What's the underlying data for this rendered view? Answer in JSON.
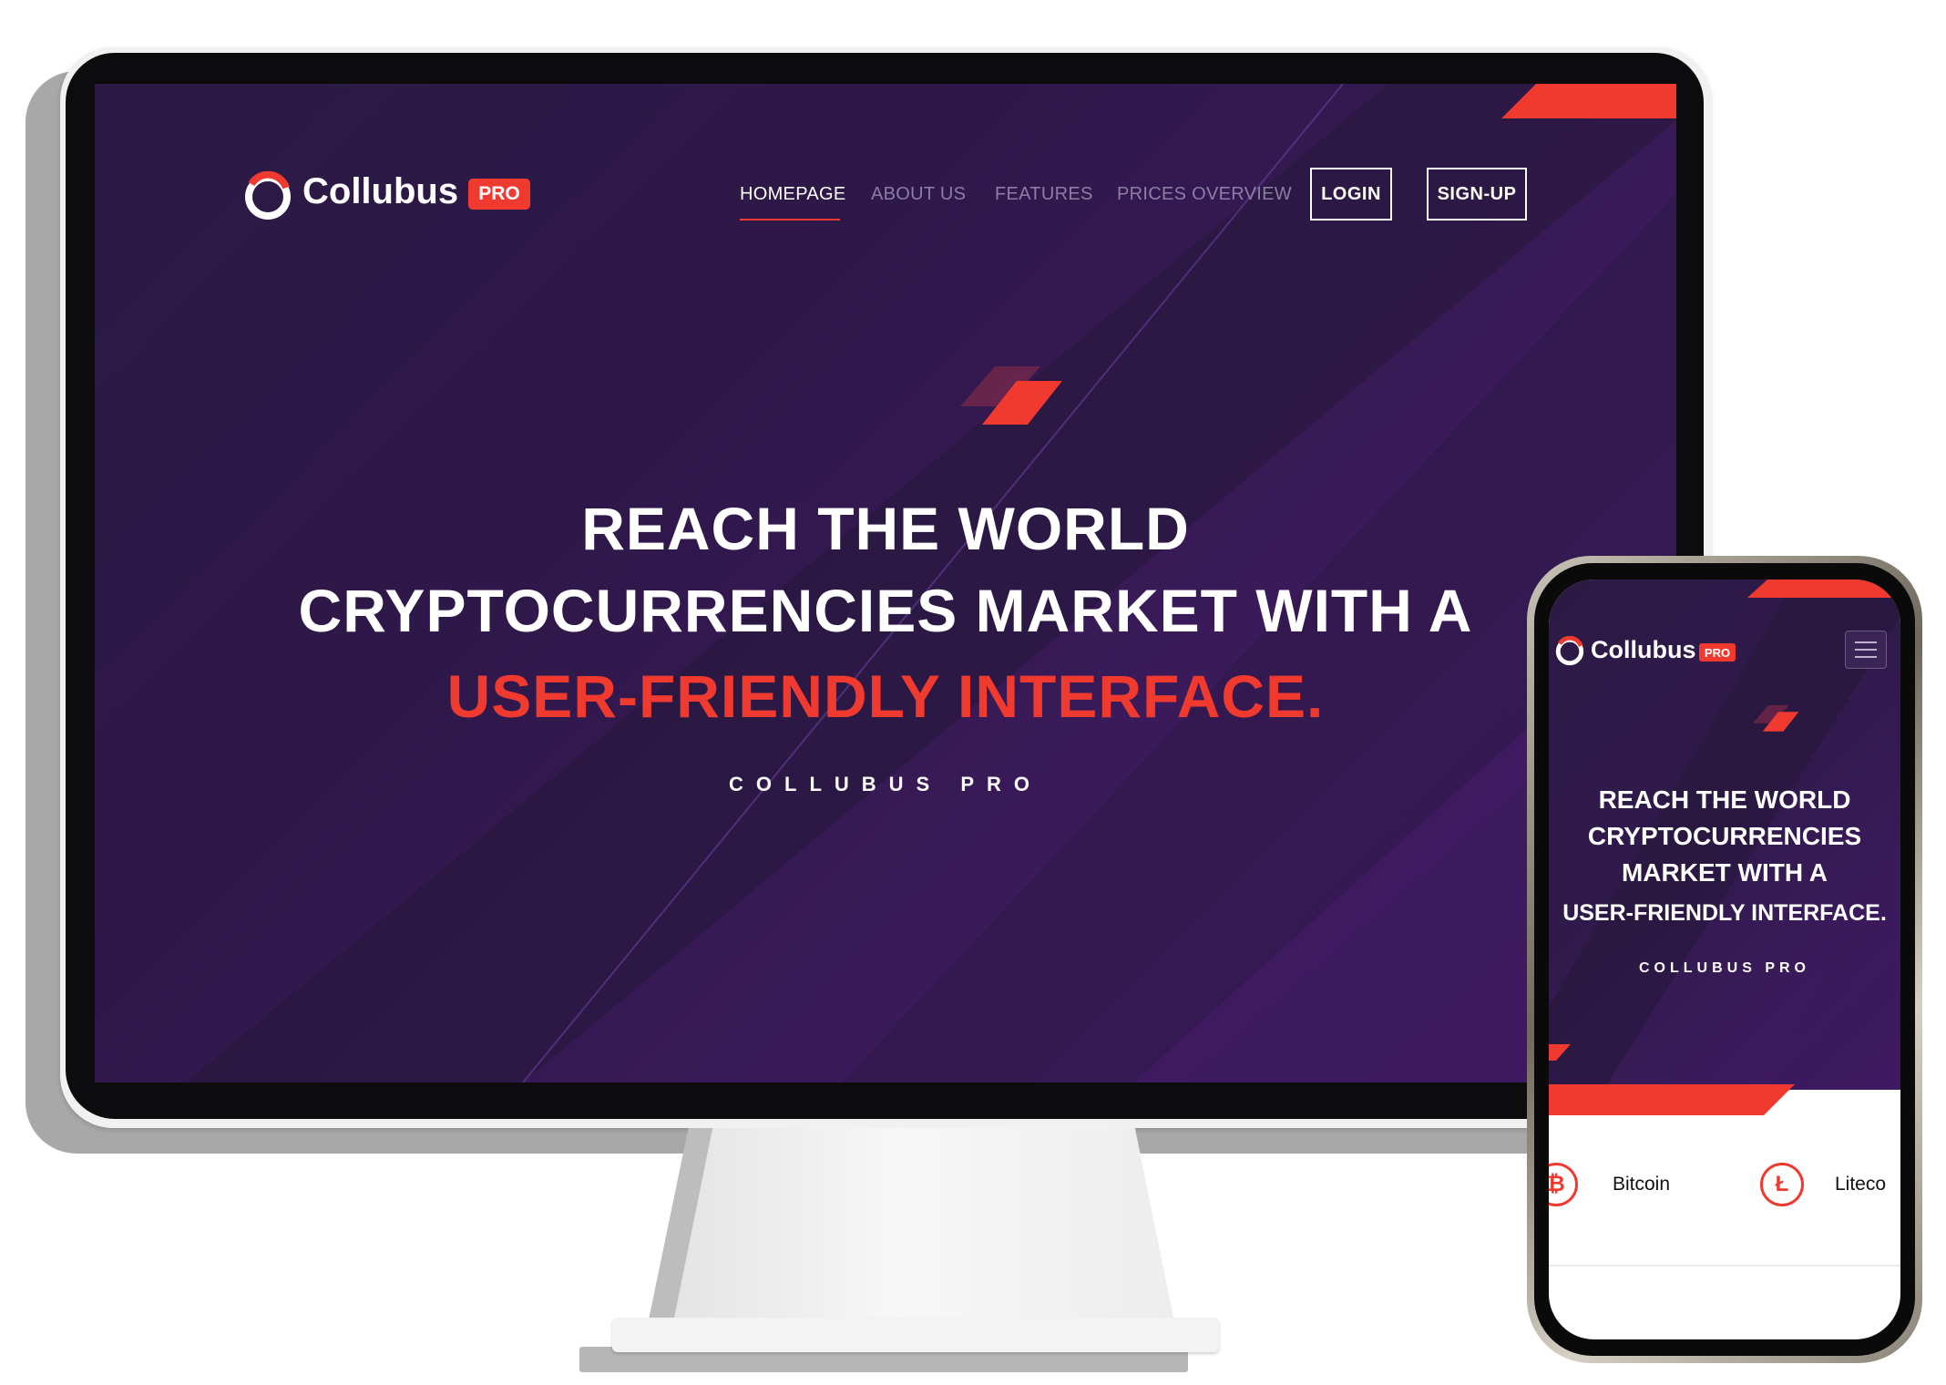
{
  "brand": {
    "name": "Collubus",
    "badge": "PRO"
  },
  "nav": {
    "items": [
      "HOMEPAGE",
      "ABOUT US",
      "FEATURES",
      "PRICES OVERVIEW"
    ],
    "login": "LOGIN",
    "signup": "SIGN-UP"
  },
  "hero": {
    "line1": "REACH THE WORLD",
    "line2": "CRYPTOCURRENCIES MARKET WITH A",
    "line3": "USER-FRIENDLY INTERFACE.",
    "subtitle": "COLLUBUS PRO"
  },
  "mobile": {
    "line1": "REACH THE WORLD",
    "line2": "CRYPTOCURRENCIES",
    "line3": "MARKET WITH A",
    "line4": "USER-FRIENDLY INTERFACE.",
    "subtitle": "COLLUBUS PRO",
    "coins": [
      {
        "name": "Bitcoin",
        "icon": "bitcoin-icon",
        "glyph": "₿"
      },
      {
        "name": "Liteco",
        "icon": "litecoin-icon",
        "glyph": "Ł"
      }
    ]
  },
  "colors": {
    "accent": "#f03a2f",
    "bg_dark": "#2c1a44",
    "bg_purple": "#45196a"
  }
}
